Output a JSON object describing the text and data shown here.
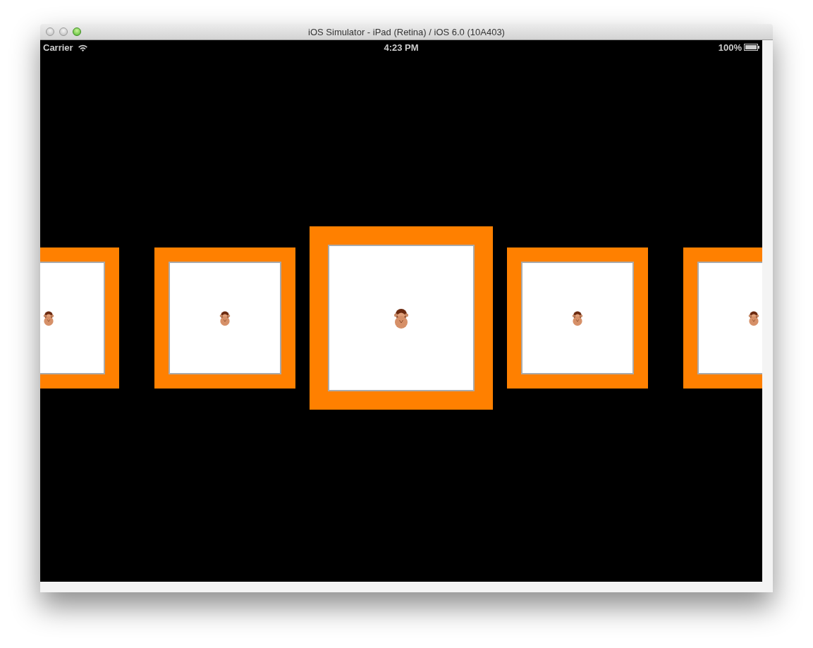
{
  "window": {
    "title": "iOS Simulator - iPad (Retina) / iOS 6.0 (10A403)"
  },
  "status_bar": {
    "carrier": "Carrier",
    "time": "4:23 PM",
    "battery": "100%"
  },
  "carousel": {
    "items": [
      {
        "selected": false
      },
      {
        "selected": false
      },
      {
        "selected": true
      },
      {
        "selected": false
      },
      {
        "selected": false
      }
    ]
  }
}
